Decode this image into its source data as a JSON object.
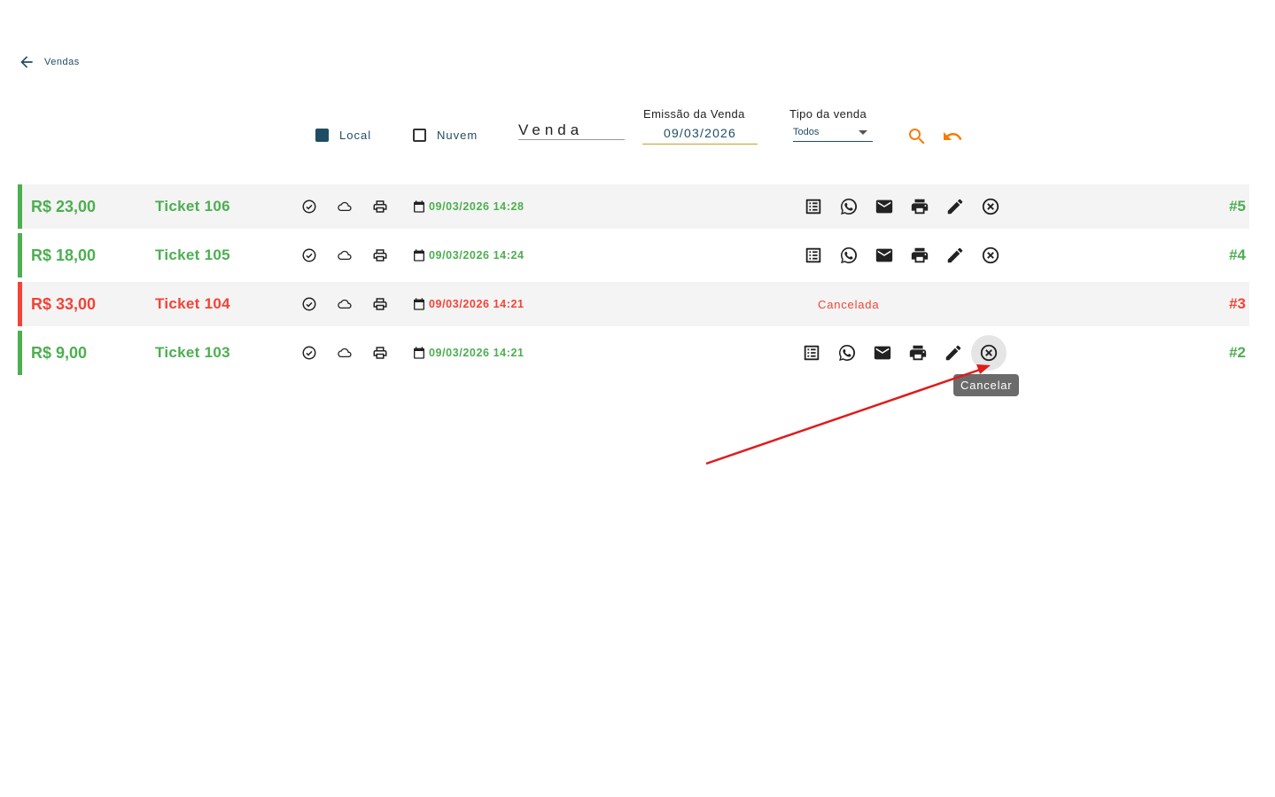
{
  "header": {
    "back_label": "Vendas"
  },
  "filters": {
    "local_label": "Local",
    "local_checked": true,
    "nuvem_label": "Nuvem",
    "nuvem_checked": false,
    "venda_placeholder": "Venda",
    "emissao_label": "Emissão da Venda",
    "emissao_value": "09/03/2026",
    "tipo_label": "Tipo da venda",
    "tipo_value": "Todos"
  },
  "colors": {
    "accent": "#f57c00",
    "primary": "#1e4d63",
    "ok": "#4caf50",
    "cancel": "#f44336"
  },
  "rows": [
    {
      "amount": "R$ 23,00",
      "ticket": "Ticket 106",
      "datetime": "09/03/2026 14:28",
      "number": "#5",
      "status": "ok"
    },
    {
      "amount": "R$ 18,00",
      "ticket": "Ticket 105",
      "datetime": "09/03/2026 14:24",
      "number": "#4",
      "status": "ok"
    },
    {
      "amount": "R$ 33,00",
      "ticket": "Ticket 104",
      "datetime": "09/03/2026 14:21",
      "number": "#3",
      "status": "cancelled",
      "status_label": "Cancelada"
    },
    {
      "amount": "R$ 9,00",
      "ticket": "Ticket 103",
      "datetime": "09/03/2026 14:21",
      "number": "#2",
      "status": "ok"
    }
  ],
  "tooltip": {
    "text": "Cancelar"
  }
}
